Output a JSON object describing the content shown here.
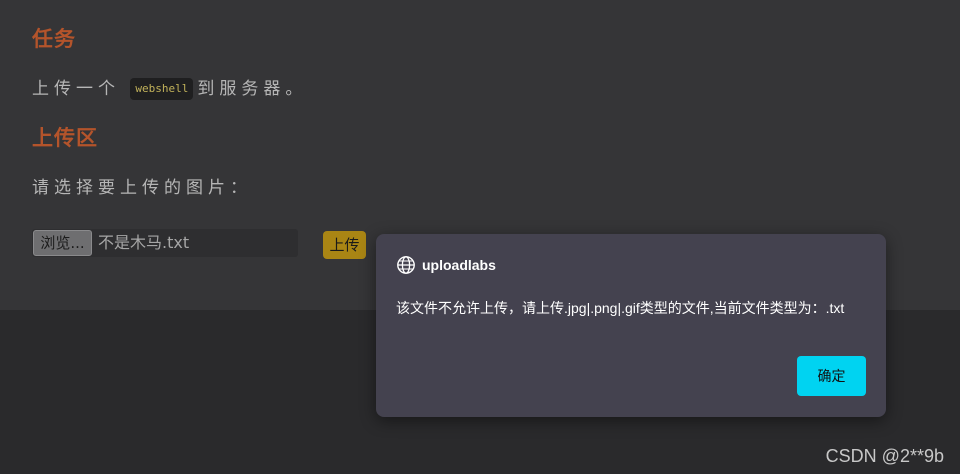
{
  "page": {
    "task_heading": "任务",
    "task_text_before": "上传一个",
    "task_code": "webshell",
    "task_text_after": "到服务器。",
    "upload_heading": "上传区",
    "select_prompt": "请选择要上传的图片：",
    "browse_label": "浏览...",
    "file_name": "不是木马.txt",
    "upload_label": "上传"
  },
  "dialog": {
    "title": "uploadlabs",
    "icon": "globe-icon",
    "message": "该文件不允许上传，请上传.jpg|.png|.gif类型的文件,当前文件类型为：.txt",
    "ok_label": "确定",
    "ok_color": "#00d3f1"
  },
  "watermark": "CSDN @2**9b",
  "colors": {
    "heading": "#b4542b",
    "upload_button": "#a98514",
    "code_text": "#c2b25a"
  }
}
